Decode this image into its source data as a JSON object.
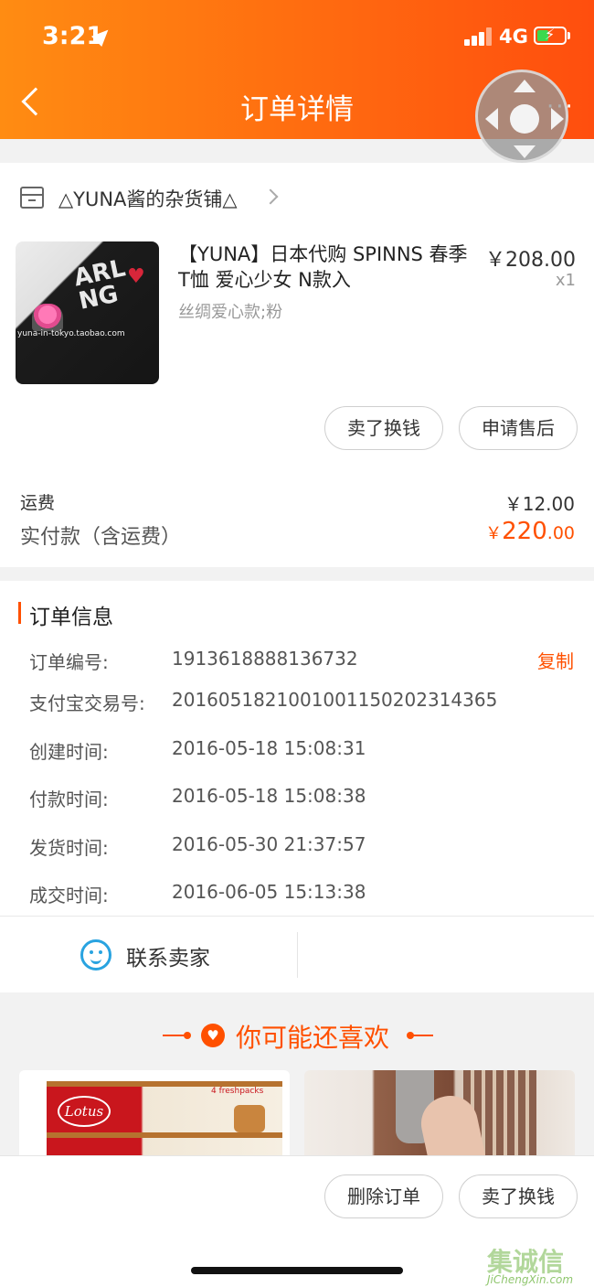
{
  "status_bar": {
    "time": "3:21",
    "network": "4G"
  },
  "nav": {
    "title": "订单详情",
    "more": "···"
  },
  "shop": {
    "name": "△YUNA酱的杂货铺△"
  },
  "product": {
    "name": "【YUNA】日本代购 SPINNS 春季T恤 爱心少女 N款入",
    "spec": "丝绸爱心款;粉",
    "price": "￥208.00",
    "qty": "x1",
    "image_text": "ARL NG",
    "image_watermark": "yuna-in-tokyo.taobao.com"
  },
  "item_actions": {
    "sell": "卖了换钱",
    "after_sale": "申请售后"
  },
  "costs": {
    "freight_label": "运费",
    "freight_value": "￥12.00",
    "paid_label": "实付款（含运费）",
    "paid_currency": "￥",
    "paid_integer": "220",
    "paid_decimal": ".00"
  },
  "order_info": {
    "title": "订单信息",
    "copy": "复制",
    "rows": [
      {
        "label": "订单编号:",
        "value": "1913618888136732"
      },
      {
        "label": "支付宝交易号:",
        "value": "2016051821001001150202314365"
      },
      {
        "label": "创建时间:",
        "value": "2016-05-18 15:08:31"
      },
      {
        "label": "付款时间:",
        "value": "2016-05-18 15:08:38"
      },
      {
        "label": "发货时间:",
        "value": "2016-05-30 21:37:57"
      },
      {
        "label": "成交时间:",
        "value": "2016-06-05 15:13:38"
      }
    ]
  },
  "contact": {
    "label": "联系卖家"
  },
  "recommend": {
    "title": "你可能还喜欢",
    "item1_brand": "Lotus",
    "item1_pack": "4 freshpacks"
  },
  "bottom_actions": {
    "delete": "删除订单",
    "sell": "卖了换钱"
  },
  "watermark": {
    "cn": "集诚信",
    "en": "JiChengXin.com"
  },
  "colors": {
    "accent": "#ff5000",
    "header_start": "#ff8c12",
    "header_end": "#ff4e0e",
    "contact_icon": "#29a3e0"
  }
}
